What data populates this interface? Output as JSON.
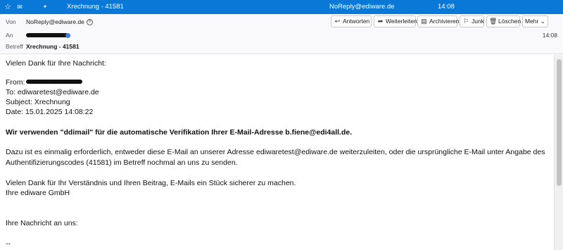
{
  "list_row": {
    "subject": "Xrechnung - 41581",
    "sender": "NoReply@ediware.de",
    "date": "14:08",
    "star_glyph": "☆",
    "read_glyph": "✉",
    "thread_glyph": "●"
  },
  "header": {
    "from_label": "Von",
    "from_value": "NoReply@ediware.de",
    "to_label": "An",
    "subject_label": "Betreff",
    "subject_value": "Xrechnung - 41581",
    "date": "14:08"
  },
  "toolbar": {
    "reply": "Antworten",
    "forward": "Weiterleiten",
    "archive": "Archivieren",
    "junk": "Junk",
    "delete": "Löschen",
    "more": "Mehr"
  },
  "body": {
    "greeting": "Vielen Dank für Ihre Nachricht:",
    "from_line": "From:",
    "to_line": "To: ediwaretest@ediware.de",
    "subject_line": "Subject: Xrechnung",
    "date_line": "Date: 15.01.2025 14:08:22",
    "bold_line": "Wir verwenden \"ddimail\" für die automatische Verifikation Ihrer E-Mail-Adresse b.fiene@edi4all.de.",
    "para1_line1": "Dazu ist es einmalig erforderlich, entweder diese E-Mail an unserer Adresse ediwaretest@ediware.de weiterzuleiten, oder die ursprüngliche E-Mail unter Angabe des",
    "para1_line2": "Authentifizierungscodes (41581) im Betreff nochmal an uns zu senden.",
    "thanks": "Vielen Dank für Ihr Verständnis und Ihren Beitrag, E-Mails ein Stück sicherer zu machen.",
    "signature": "Ihre ediware GmbH",
    "your_message": "Ihre Nachricht an uns:",
    "separator": "--"
  },
  "colors": {
    "selection_blue": "#0a78d7",
    "header_bg": "#f9f9fb"
  }
}
